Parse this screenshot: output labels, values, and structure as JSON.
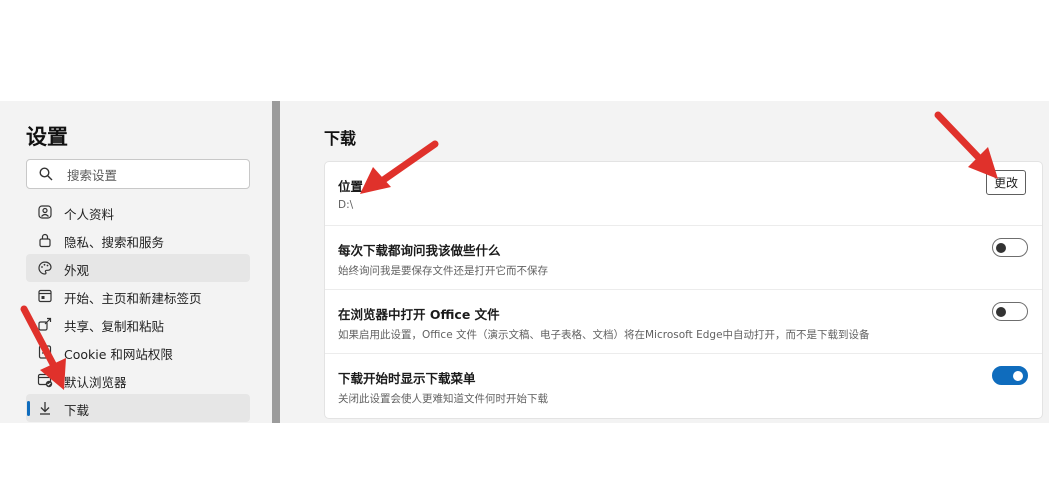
{
  "sidebar": {
    "title": "设置",
    "search_placeholder": "搜索设置",
    "items": [
      {
        "label": "个人资料",
        "icon": "profile-icon"
      },
      {
        "label": "隐私、搜索和服务",
        "icon": "lock-icon"
      },
      {
        "label": "外观",
        "icon": "palette-icon"
      },
      {
        "label": "开始、主页和新建标签页",
        "icon": "start-page-icon"
      },
      {
        "label": "共享、复制和粘贴",
        "icon": "share-icon"
      },
      {
        "label": "Cookie 和网站权限",
        "icon": "site-permissions-icon"
      },
      {
        "label": "默认浏览器",
        "icon": "default-browser-icon"
      },
      {
        "label": "下载",
        "icon": "download-icon"
      }
    ],
    "hovered_item": "外观",
    "active_item": "下载"
  },
  "main": {
    "title": "下载",
    "location": {
      "title": "位置",
      "value": "D:\\",
      "change_label": "更改"
    },
    "ask_each_time": {
      "title": "每次下载都询问我该做些什么",
      "desc": "始终询问我是要保存文件还是打开它而不保存",
      "enabled": false
    },
    "open_office": {
      "title": "在浏览器中打开 Office 文件",
      "desc": "如果启用此设置，Office 文件（演示文稿、电子表格、文档）将在Microsoft Edge中自动打开，而不是下载到设备",
      "enabled": false
    },
    "show_menu": {
      "title": "下载开始时显示下载菜单",
      "desc": "关闭此设置会使人更难知道文件何时开始下载",
      "enabled": true
    }
  },
  "colors": {
    "accent": "#0f6cbd",
    "annotation_arrow": "#e0312b"
  }
}
